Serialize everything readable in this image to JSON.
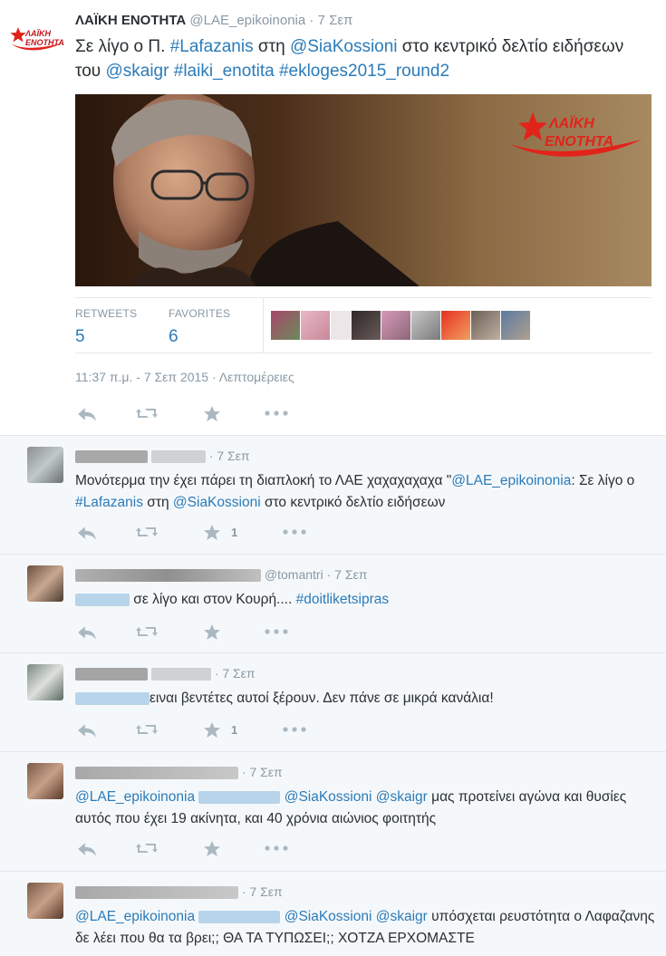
{
  "main_tweet": {
    "fullname": "ΛΑΪΚΗ ΕΝΟΤΗΤΑ",
    "handle": "@LAE_epikoinonia",
    "time": "7 Σεπ",
    "logo_text_1": "ΛΑΪΚΗ",
    "logo_text_2": "ΕΝΟΤΗΤΑ",
    "text_1": "Σε λίγο ο Π. ",
    "tag_lafazanis": "#Lafazanis",
    "text_2": " στη ",
    "mention_sia": "@SiaKossioni",
    "text_3": " στο κεντρικό δελτίο ειδήσεων του ",
    "mention_skai": "@skaigr",
    "text_4": " ",
    "tag_laiki": "#laiki_enotita",
    "text_5": " ",
    "tag_ekloges": "#ekloges2015_round2",
    "photo_logo_1": "ΛΑΪΚΗ",
    "photo_logo_2": "ΕΝΟΤΗΤΑ",
    "retweets_label": "RETWEETS",
    "retweets_value": "5",
    "favorites_label": "FAVORITES",
    "favorites_value": "6",
    "timestamp": "11:37 π.μ. - 7 Σεπ 2015 · Λεπτομέρειες"
  },
  "replies": [
    {
      "time": "7 Σεπ",
      "text_a": "Μονότερμα την έχει πάρει τη διαπλοκή το ΛΑΕ χαχαχαχαχα \"",
      "mention_a": "@LAE_epikoinonia",
      "text_b": ": Σε λίγο ο ",
      "tag_a": "#Lafazanis",
      "text_c": " στη ",
      "mention_b": "@SiaKossioni",
      "text_d": " στο κεντρικό δελτίο ειδήσεων",
      "fav_count": "1"
    },
    {
      "handle": "@tomantri",
      "time": "7 Σεπ",
      "text_a": " σε λίγο και στον Κουρή.... ",
      "tag_a": "#doitliketsipras"
    },
    {
      "time": "7 Σεπ",
      "text_a": "ειναι βεντέτες αυτοί ξέρουν. Δεν πάνε σε μικρά κανάλια!",
      "fav_count": "1"
    },
    {
      "time": "7 Σεπ",
      "mention_a": "@LAE_epikoinonia",
      "mention_b": "@SiaKossioni",
      "mention_c": "@skaigr",
      "text_a": " μας προτείνει αγώνα και θυσίες αυτός που έχει 19 ακίνητα, και 40 χρόνια αιώνιος φοιτητής"
    },
    {
      "time": "7 Σεπ",
      "mention_a": "@LAE_epikoinonia",
      "mention_b": "@SiaKossioni",
      "mention_c": "@skaigr",
      "text_a": " υπόσχεται ρευστότητα ο Λαφαζανης δε λέει που θα τα βρει;; ΘΑ ΤΑ ΤΥΠΩΣΕΙ;; ΧΟΤΖΑ ΕΡΧΟΜΑΣΤΕ"
    }
  ],
  "colors": {
    "link": "#2b7bb9",
    "muted": "#8899a6",
    "text": "#292f33",
    "reply_bg": "#f5f8fa",
    "brand_red": "#e2231a"
  },
  "icons": [
    "reply-icon",
    "retweet-icon",
    "star-icon",
    "more-icon"
  ]
}
